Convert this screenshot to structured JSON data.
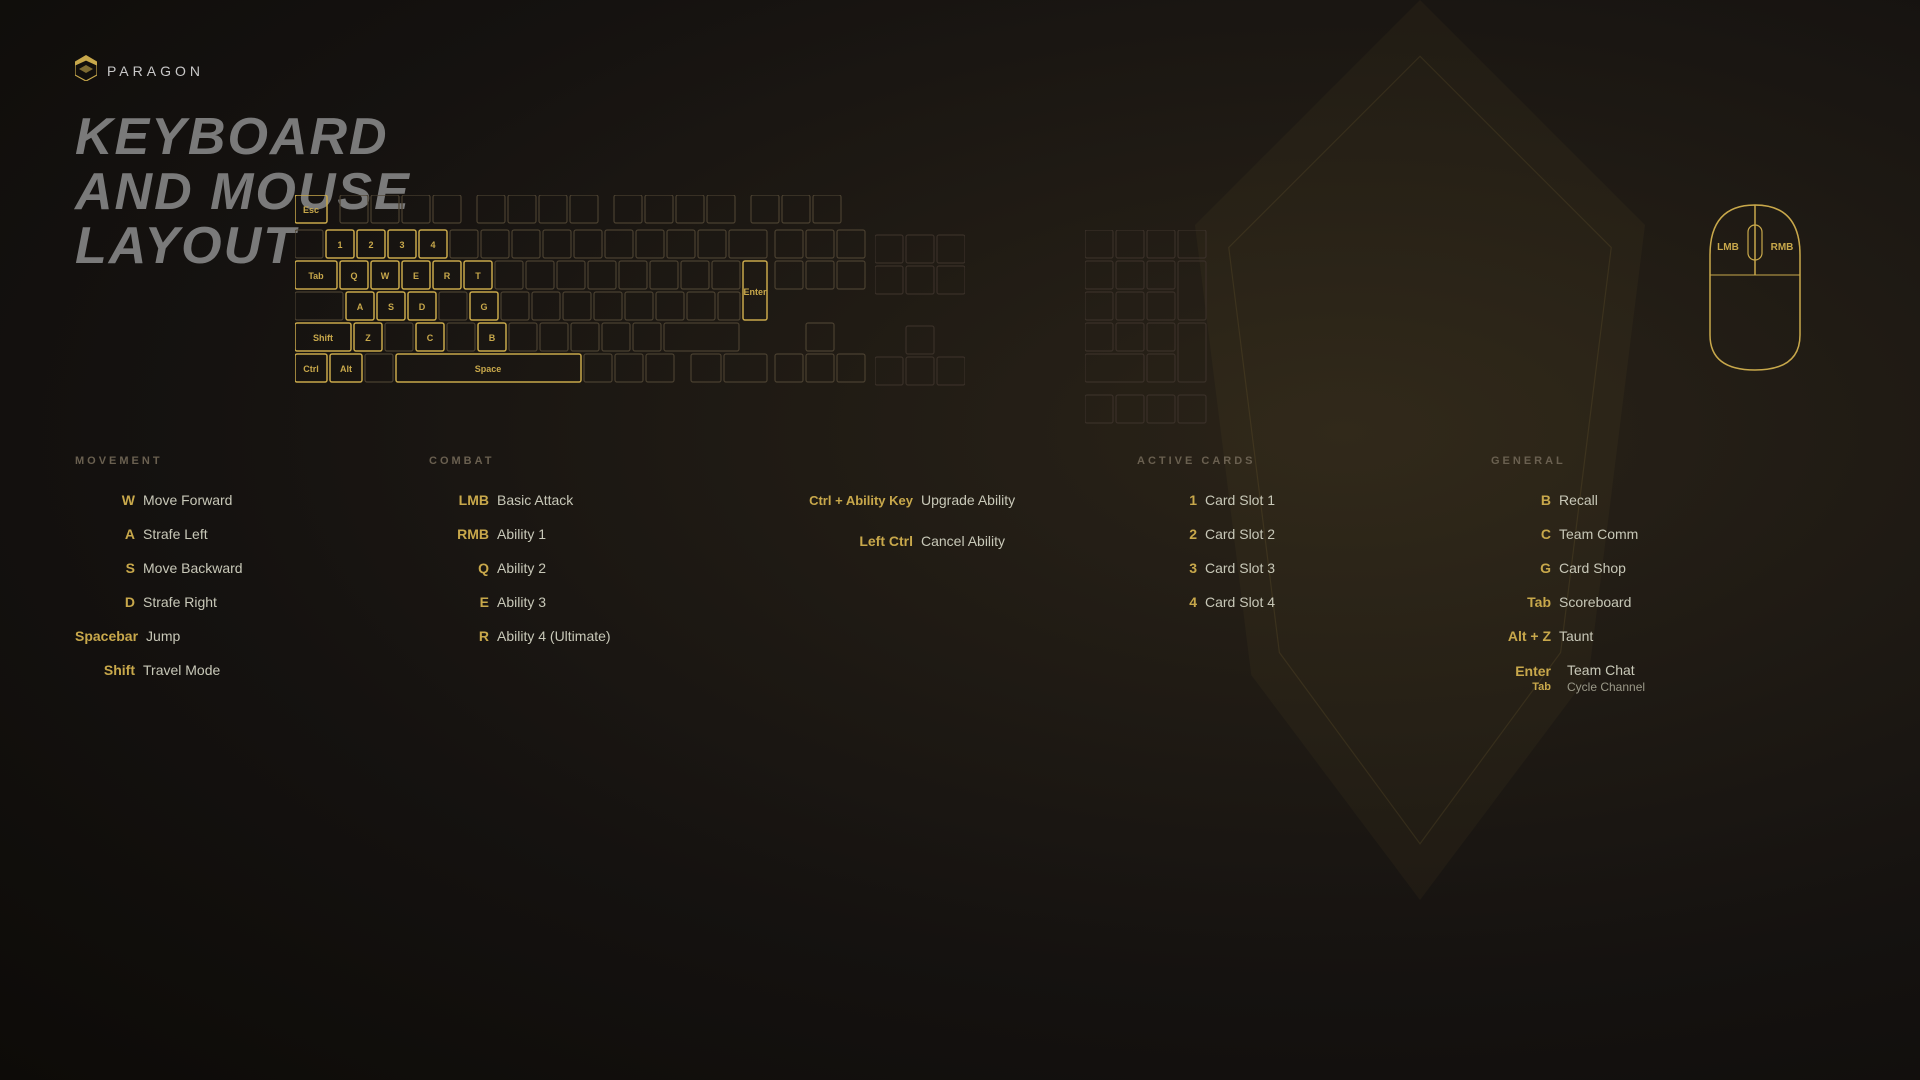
{
  "logo": {
    "text": "PARAGON"
  },
  "title": {
    "line1": "KEYBOARD",
    "line2": "AND MOUSE",
    "line3": "LAYOUT"
  },
  "sections": {
    "movement": {
      "title": "MOVEMENT",
      "bindings": [
        {
          "key": "W",
          "action": "Move Forward"
        },
        {
          "key": "A",
          "action": "Strafe Left"
        },
        {
          "key": "S",
          "action": "Move Backward"
        },
        {
          "key": "D",
          "action": "Strafe Right"
        },
        {
          "key": "Spacebar",
          "action": "Jump"
        },
        {
          "key": "Shift",
          "action": "Travel Mode"
        }
      ]
    },
    "combat": {
      "title": "COMBAT",
      "bindings": [
        {
          "key": "LMB",
          "action": "Basic Attack"
        },
        {
          "key": "RMB",
          "action": "Ability 1"
        },
        {
          "key": "Q",
          "action": "Ability 2"
        },
        {
          "key": "E",
          "action": "Ability 3"
        },
        {
          "key": "R",
          "action": "Ability 4 (Ultimate)"
        }
      ]
    },
    "combo": {
      "bindings": [
        {
          "key": "Ctrl + Ability Key",
          "action": "Upgrade Ability"
        },
        {
          "key": "Left Ctrl",
          "action": "Cancel Ability"
        }
      ]
    },
    "active_cards": {
      "title": "ACTIVE CARDS",
      "bindings": [
        {
          "key": "1",
          "action": "Card Slot 1"
        },
        {
          "key": "2",
          "action": "Card Slot 2"
        },
        {
          "key": "3",
          "action": "Card Slot 3"
        },
        {
          "key": "4",
          "action": "Card Slot 4"
        }
      ]
    },
    "general": {
      "title": "GENERAL",
      "bindings": [
        {
          "key": "B",
          "action": "Recall"
        },
        {
          "key": "C",
          "action": "Team Comm"
        },
        {
          "key": "G",
          "action": "Card Shop"
        },
        {
          "key": "Tab",
          "action": "Scoreboard"
        },
        {
          "key": "Alt + Z",
          "action": "Taunt"
        },
        {
          "key": "Enter",
          "action": "Team Chat",
          "sub_key": "Tab",
          "sub_action": "Cycle Channel"
        }
      ]
    }
  }
}
